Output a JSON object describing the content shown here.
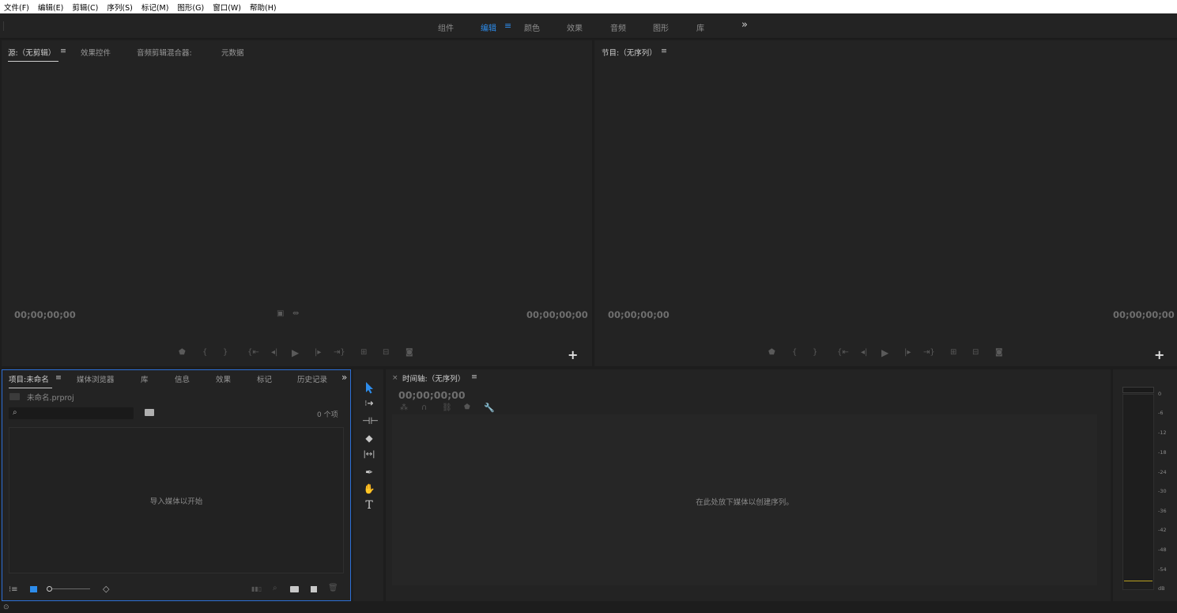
{
  "menu": [
    "文件(F)",
    "编辑(E)",
    "剪辑(C)",
    "序列(S)",
    "标记(M)",
    "图形(G)",
    "窗口(W)",
    "帮助(H)"
  ],
  "workspaces": {
    "items": [
      "组件",
      "编辑",
      "颜色",
      "效果",
      "音频",
      "图形",
      "库"
    ],
    "active": "编辑",
    "more": "»"
  },
  "source_panel": {
    "tabs": [
      "源:（无剪辑）",
      "效果控件",
      "音频剪辑混合器:",
      "元数据"
    ],
    "tc_left": "00;00;00;00",
    "tc_right": "00;00;00;00",
    "add": "+"
  },
  "program_panel": {
    "tab": "节目:（无序列）",
    "tc_left": "00;00;00;00",
    "tc_right": "00;00;00;00",
    "add": "+"
  },
  "project_panel": {
    "tabs": [
      "项目:未命名",
      "媒体浏览器",
      "库",
      "信息",
      "效果",
      "标记",
      "历史记录"
    ],
    "more": "»",
    "filename": "未命名.prproj",
    "search_placeholder": "",
    "item_count": "0 个项",
    "empty_msg": "导入媒体以开始"
  },
  "timeline_panel": {
    "close": "×",
    "tab": "时间轴:（无序列）",
    "timecode": "00;00;00;00",
    "empty_msg": "在此处放下媒体以创建序列。"
  },
  "audio_meter": {
    "labels": [
      "0",
      "-6",
      "-12",
      "-18",
      "-24",
      "-30",
      "-36",
      "-42",
      "-48",
      "-54",
      "dB"
    ]
  },
  "colors": {
    "accent": "#2d8ceb",
    "panel_bg": "#232323",
    "app_bg": "#1d1d1d",
    "focus_border": "#2d6fd6"
  }
}
